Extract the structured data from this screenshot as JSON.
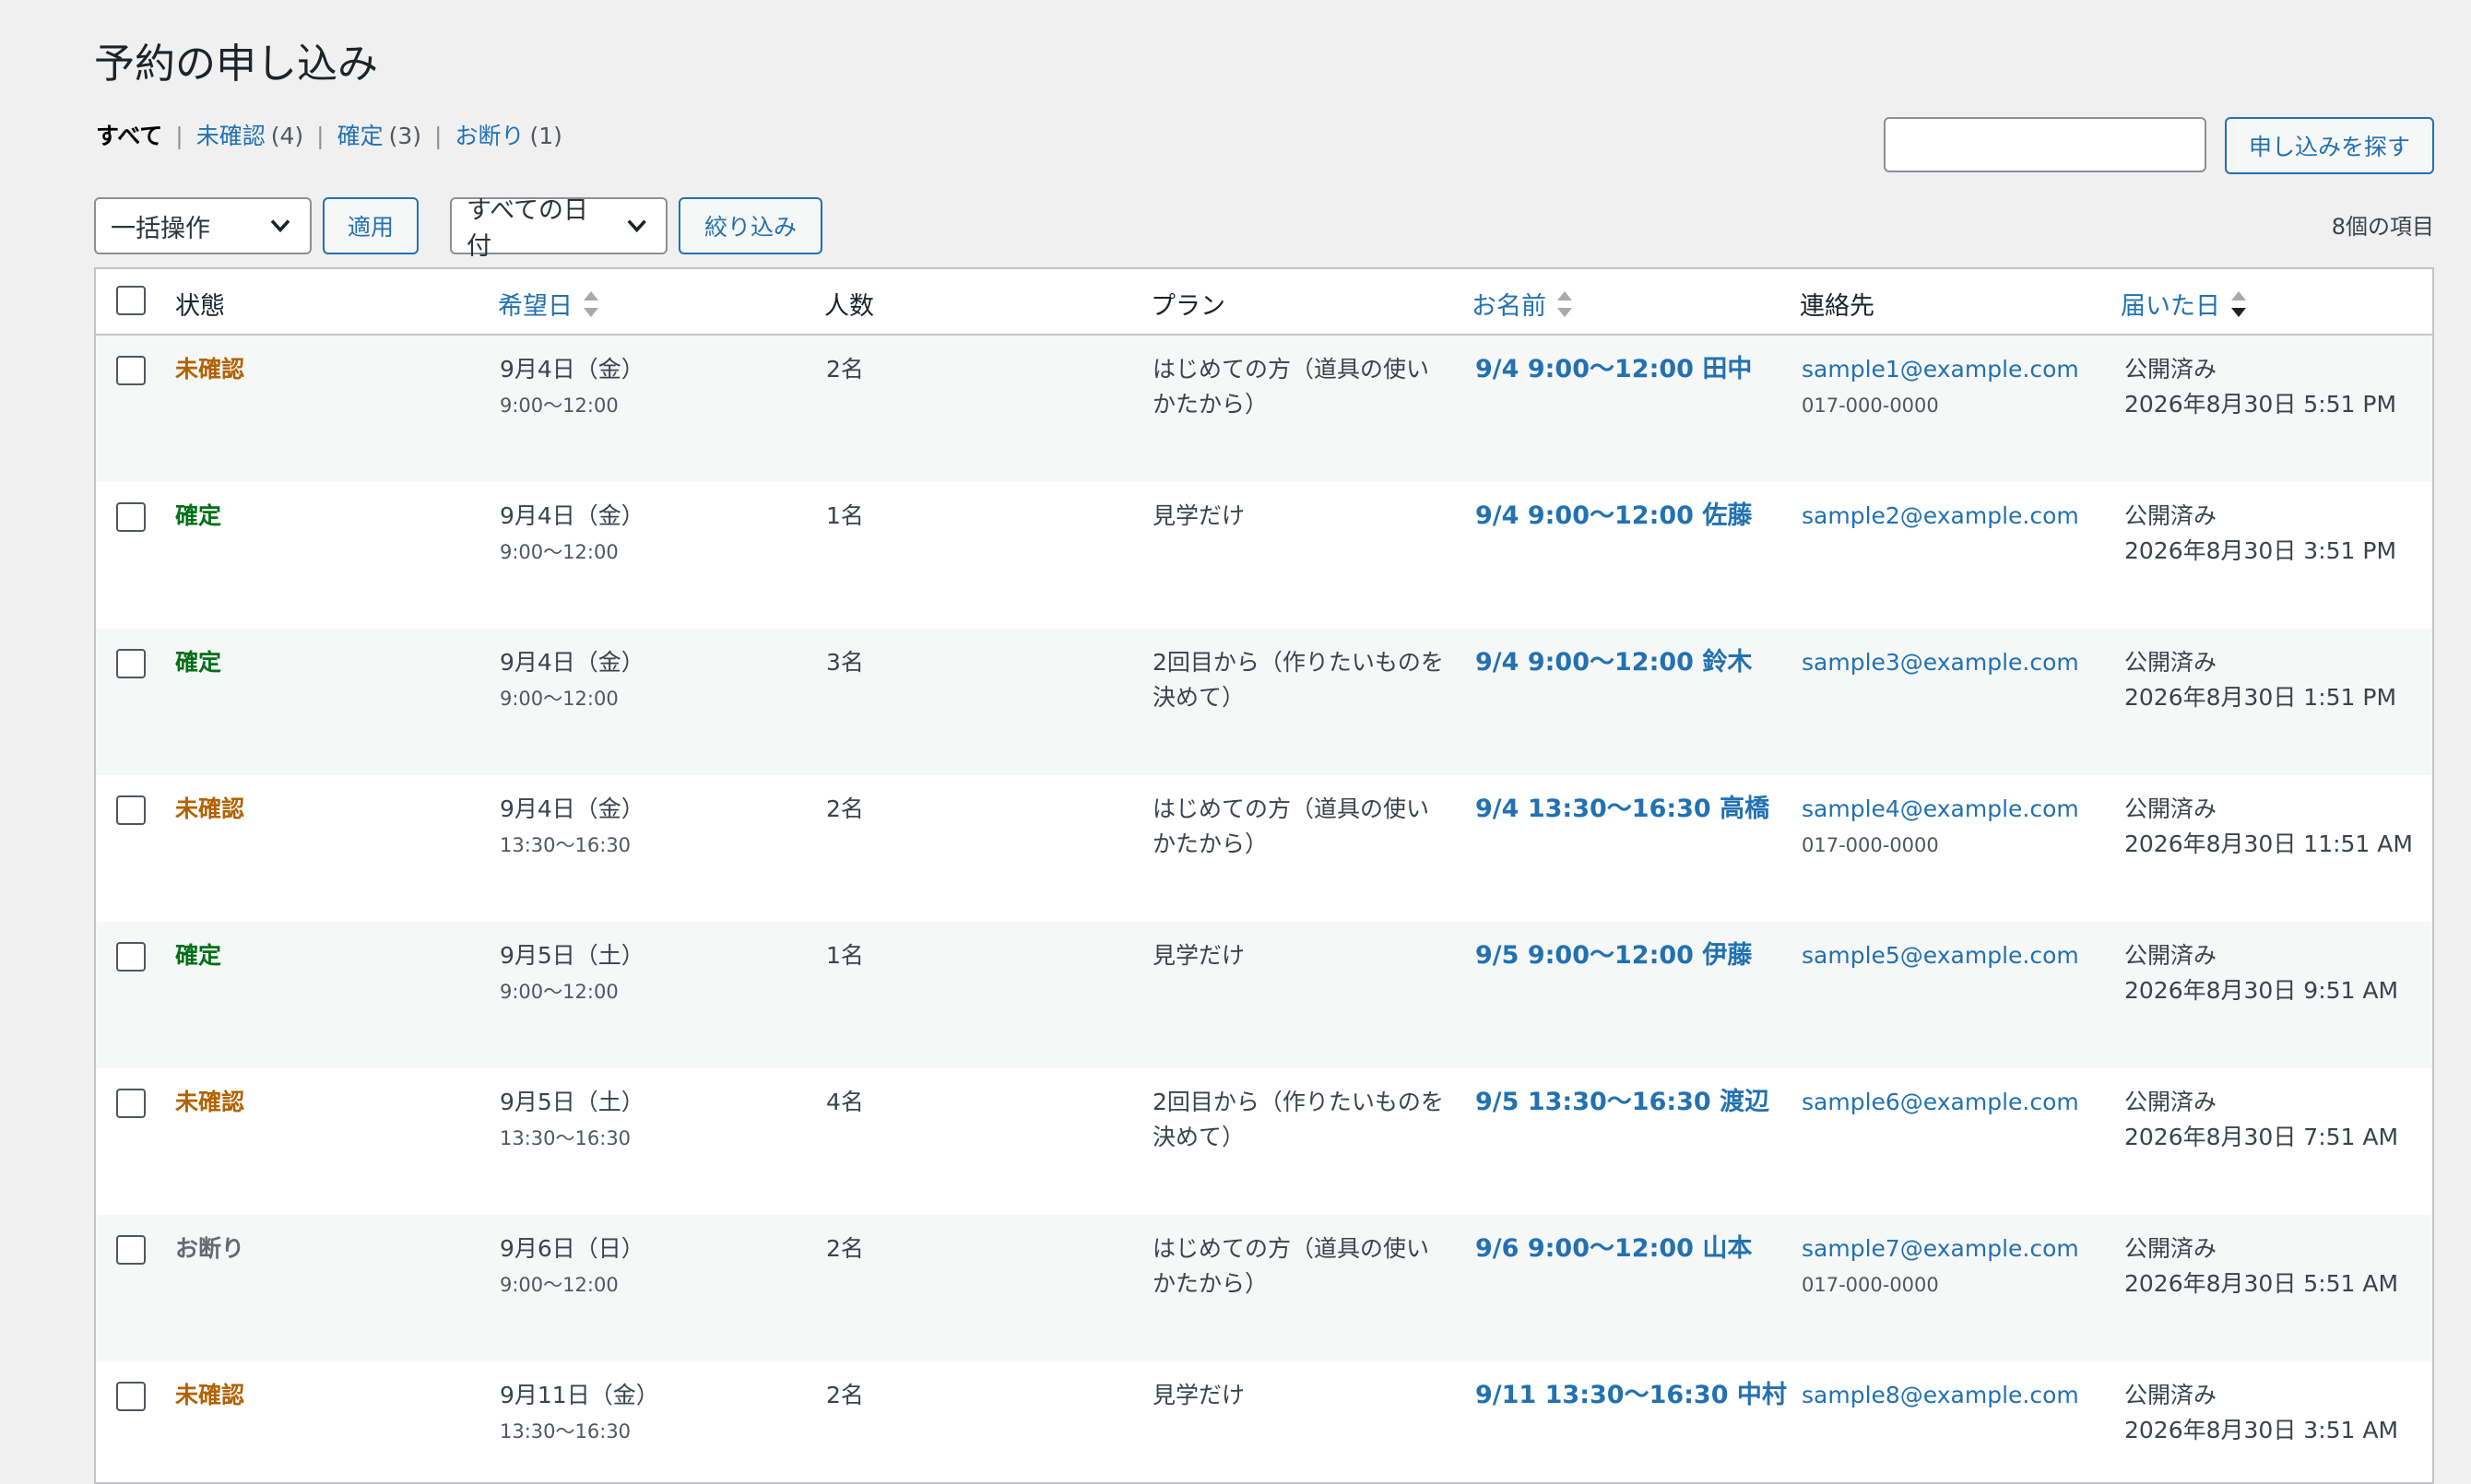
{
  "page": {
    "title": "予約の申し込み"
  },
  "filters": [
    {
      "label": "すべて",
      "count": "",
      "current": true
    },
    {
      "label": "未確認",
      "count": "(4)",
      "current": false
    },
    {
      "label": "確定",
      "count": "(3)",
      "current": false
    },
    {
      "label": "お断り",
      "count": "(1)",
      "current": false
    }
  ],
  "search": {
    "button_label": "申し込みを探す",
    "value": ""
  },
  "toolbar": {
    "bulk_select": "一括操作",
    "apply_label": "適用",
    "date_select": "すべての日付",
    "filter_label": "絞り込み",
    "items_count": "8個の項目"
  },
  "columns": {
    "status": "状態",
    "date": "希望日",
    "people": "人数",
    "plan": "プラン",
    "name": "お名前",
    "contact": "連絡先",
    "received": "届いた日"
  },
  "rows": [
    {
      "status": "未確認",
      "status_key": "pending",
      "date": "9月4日（金）",
      "time": "9:00〜12:00",
      "people": "2名",
      "plan": "はじめての方（道具の使いかたから）",
      "name": "9/4 9:00〜12:00 田中",
      "email": "sample1@example.com",
      "phone": "017-000-0000",
      "pub": "公開済み",
      "received": "2026年8月30日 5:51 PM"
    },
    {
      "status": "確定",
      "status_key": "confirmed",
      "date": "9月4日（金）",
      "time": "9:00〜12:00",
      "people": "1名",
      "plan": "見学だけ",
      "name": "9/4 9:00〜12:00 佐藤",
      "email": "sample2@example.com",
      "phone": "",
      "pub": "公開済み",
      "received": "2026年8月30日 3:51 PM"
    },
    {
      "status": "確定",
      "status_key": "confirmed",
      "date": "9月4日（金）",
      "time": "9:00〜12:00",
      "people": "3名",
      "plan": "2回目から（作りたいものを決めて）",
      "name": "9/4 9:00〜12:00 鈴木",
      "email": "sample3@example.com",
      "phone": "",
      "pub": "公開済み",
      "received": "2026年8月30日 1:51 PM"
    },
    {
      "status": "未確認",
      "status_key": "pending",
      "date": "9月4日（金）",
      "time": "13:30〜16:30",
      "people": "2名",
      "plan": "はじめての方（道具の使いかたから）",
      "name": "9/4 13:30〜16:30 高橋",
      "email": "sample4@example.com",
      "phone": "017-000-0000",
      "pub": "公開済み",
      "received": "2026年8月30日 11:51 AM"
    },
    {
      "status": "確定",
      "status_key": "confirmed",
      "date": "9月5日（土）",
      "time": "9:00〜12:00",
      "people": "1名",
      "plan": "見学だけ",
      "name": "9/5 9:00〜12:00 伊藤",
      "email": "sample5@example.com",
      "phone": "",
      "pub": "公開済み",
      "received": "2026年8月30日 9:51 AM"
    },
    {
      "status": "未確認",
      "status_key": "pending",
      "date": "9月5日（土）",
      "time": "13:30〜16:30",
      "people": "4名",
      "plan": "2回目から（作りたいものを決めて）",
      "name": "9/5 13:30〜16:30 渡辺",
      "email": "sample6@example.com",
      "phone": "",
      "pub": "公開済み",
      "received": "2026年8月30日 7:51 AM"
    },
    {
      "status": "お断り",
      "status_key": "declined",
      "date": "9月6日（日）",
      "time": "9:00〜12:00",
      "people": "2名",
      "plan": "はじめての方（道具の使いかたから）",
      "name": "9/6 9:00〜12:00 山本",
      "email": "sample7@example.com",
      "phone": "017-000-0000",
      "pub": "公開済み",
      "received": "2026年8月30日 5:51 AM"
    },
    {
      "status": "未確認",
      "status_key": "pending",
      "date": "9月11日（金）",
      "time": "13:30〜16:30",
      "people": "2名",
      "plan": "見学だけ",
      "name": "9/11 13:30〜16:30 中村",
      "email": "sample8@example.com",
      "phone": "",
      "pub": "公開済み",
      "received": "2026年8月30日 3:51 AM"
    }
  ],
  "colors": {
    "pending": "#b26200",
    "confirmed": "#007017",
    "declined": "#646970",
    "link": "#2271b1"
  }
}
